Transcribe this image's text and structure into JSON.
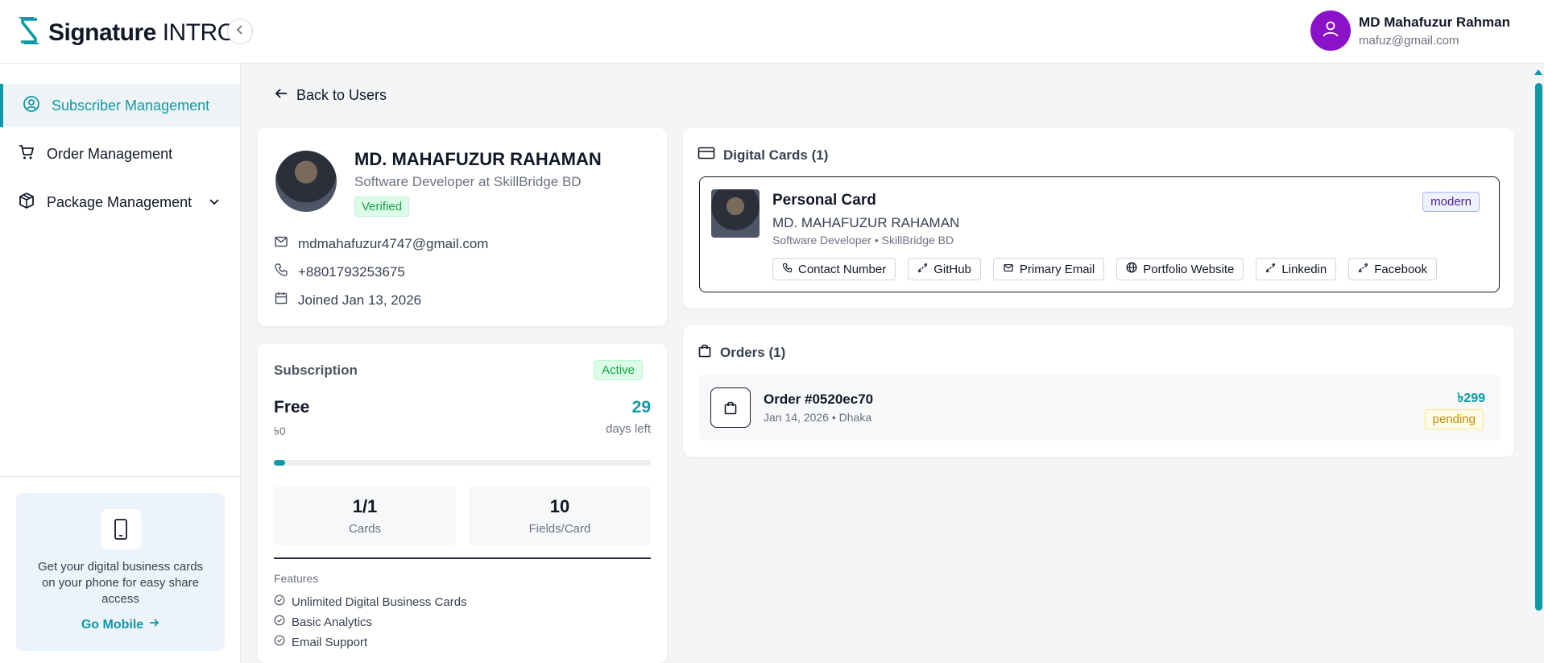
{
  "brand": {
    "name_bold": "Signature",
    "name_light": "INTRO",
    "logo_icon": "s-logo-icon",
    "accent": "#0d9aa6"
  },
  "user": {
    "name": "MD Mahafuzur Rahman",
    "email": "mafuz@gmail.com",
    "avatar_color": "#8b12c9"
  },
  "sidebar": {
    "items": [
      {
        "label": "Subscriber Management",
        "icon": "user-circle-icon",
        "active": true
      },
      {
        "label": "Order Management",
        "icon": "cart-icon",
        "active": false
      },
      {
        "label": "Package Management",
        "icon": "package-icon",
        "active": false,
        "expandable": true
      }
    ],
    "promo": {
      "text": "Get your digital business cards on your phone for easy share access",
      "link": "Go Mobile"
    }
  },
  "main": {
    "back_label": "Back to Users",
    "profile": {
      "name": "MD. MAHAFUZUR RAHAMAN",
      "role": "Software Developer at SkillBridge BD",
      "status": "Verified",
      "email": "mdmahafuzur4747@gmail.com",
      "phone": "+8801793253675",
      "joined": "Joined Jan 13, 2026"
    },
    "subscription": {
      "title": "Subscription",
      "status": "Active",
      "plan": "Free",
      "price": "৳0",
      "days_num": "29",
      "days_label": "days left",
      "progress_percent": 3,
      "stats": [
        {
          "value": "1/1",
          "label": "Cards"
        },
        {
          "value": "10",
          "label": "Fields/Card"
        }
      ],
      "features_title": "Features",
      "features": [
        "Unlimited Digital Business Cards",
        "Basic Analytics",
        "Email Support"
      ]
    },
    "digital_cards": {
      "title": "Digital Cards (1)",
      "card": {
        "title": "Personal Card",
        "name": "MD. MAHAFUZUR RAHAMAN",
        "subtitle": "Software Developer • SkillBridge BD",
        "theme": "modern",
        "links": [
          {
            "label": "Contact Number",
            "icon": "phone-icon"
          },
          {
            "label": "GitHub",
            "icon": "link-icon"
          },
          {
            "label": "Primary Email",
            "icon": "mail-icon"
          },
          {
            "label": "Portfolio Website",
            "icon": "globe-icon"
          },
          {
            "label": "Linkedin",
            "icon": "link-icon"
          },
          {
            "label": "Facebook",
            "icon": "link-icon"
          }
        ]
      }
    },
    "orders": {
      "title": "Orders (1)",
      "items": [
        {
          "id": "Order #0520ec70",
          "meta": "Jan 14, 2026 • Dhaka",
          "amount": "৳299",
          "status": "pending"
        }
      ]
    }
  }
}
